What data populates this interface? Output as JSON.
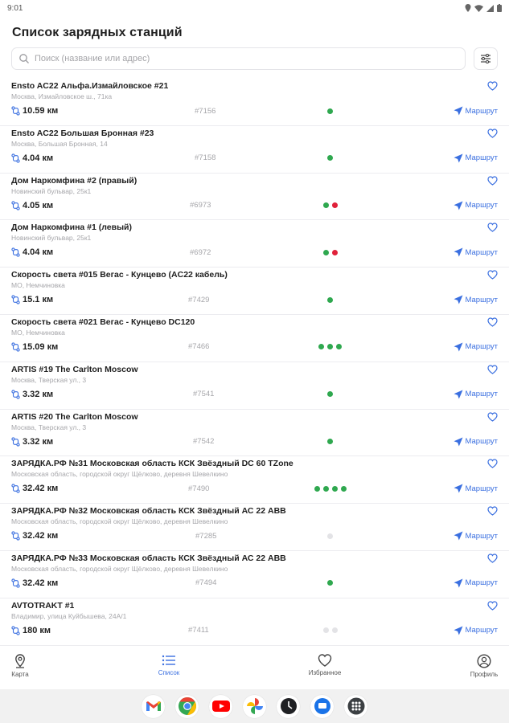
{
  "status_bar": {
    "time": "9:01"
  },
  "page": {
    "title": "Список зарядных станций",
    "search_placeholder": "Поиск (название или адрес)",
    "route_label": "Маршрут",
    "accent_color": "#3a6fe0"
  },
  "stations": [
    {
      "name": "Ensto AC22 Альфа.Измайловское #21",
      "address": "Москва, Измайловское ш., 71ка",
      "distance": "10.59 км",
      "id": "#7156",
      "statuses": [
        "green"
      ]
    },
    {
      "name": "Ensto AC22 Большая Бронная #23",
      "address": "Москва, Большая Бронная, 14",
      "distance": "4.04 км",
      "id": "#7158",
      "statuses": [
        "green"
      ]
    },
    {
      "name": "Дом Наркомфина #2 (правый)",
      "address": "Новинский бульвар, 25к1",
      "distance": "4.05 км",
      "id": "#6973",
      "statuses": [
        "green",
        "red"
      ]
    },
    {
      "name": "Дом Наркомфина #1 (левый)",
      "address": "Новинский бульвар, 25к1",
      "distance": "4.04 км",
      "id": "#6972",
      "statuses": [
        "green",
        "red"
      ]
    },
    {
      "name": "Скорость света #015 Вегас - Кунцево (AC22 кабель)",
      "address": "МО, Немчиновка",
      "distance": "15.1 км",
      "id": "#7429",
      "statuses": [
        "green"
      ]
    },
    {
      "name": "Скорость света #021 Вегас - Кунцево DC120",
      "address": "МО, Немчиновка",
      "distance": "15.09 км",
      "id": "#7466",
      "statuses": [
        "green",
        "green",
        "green"
      ]
    },
    {
      "name": "ARTIS #19 The Carlton Moscow",
      "address": "Москва, Тверская ул., 3",
      "distance": "3.32 км",
      "id": "#7541",
      "statuses": [
        "green"
      ]
    },
    {
      "name": "ARTIS #20 The Carlton Moscow",
      "address": "Москва, Тверская ул., 3",
      "distance": "3.32 км",
      "id": "#7542",
      "statuses": [
        "green"
      ]
    },
    {
      "name": "ЗАРЯДКА.РФ №31 Московская область КСК Звёздный DC 60 TZone",
      "address": "Московская область, городской округ Щёлково, деревня Шевелкино",
      "distance": "32.42 км",
      "id": "#7490",
      "statuses": [
        "green",
        "green",
        "green",
        "green"
      ]
    },
    {
      "name": "ЗАРЯДКА.РФ №32 Московская область КСК Звёздный АС 22 АВВ",
      "address": "Московская область, городской округ Щёлково, деревня Шевелкино",
      "distance": "32.42 км",
      "id": "#7285",
      "statuses": [
        "grey"
      ]
    },
    {
      "name": "ЗАРЯДКА.РФ №33 Московская область КСК Звёздный АС 22 АВВ",
      "address": "Московская область, городской округ Щёлково, деревня Шевелкино",
      "distance": "32.42 км",
      "id": "#7494",
      "statuses": [
        "green"
      ]
    },
    {
      "name": "AVTOTRAKT #1",
      "address": "Владимир, улица Куйбышева, 24А/1",
      "distance": "180 км",
      "id": "#7411",
      "statuses": [
        "grey",
        "grey"
      ]
    }
  ],
  "status_colors": {
    "green": "#2fa84f",
    "red": "#e0213a",
    "grey": "#e3e3e6"
  },
  "nav": [
    {
      "label": "Карта",
      "icon": "map-pin-icon"
    },
    {
      "label": "Список",
      "icon": "list-icon"
    },
    {
      "label": "Избранное",
      "icon": "heart-icon"
    },
    {
      "label": "Профиль",
      "icon": "profile-icon"
    }
  ],
  "dock_apps": [
    {
      "icon": "gmail-icon"
    },
    {
      "icon": "chrome-icon"
    },
    {
      "icon": "youtube-icon"
    },
    {
      "icon": "photos-icon"
    },
    {
      "icon": "clock-icon"
    },
    {
      "icon": "messages-icon"
    },
    {
      "icon": "app-drawer-icon"
    }
  ]
}
